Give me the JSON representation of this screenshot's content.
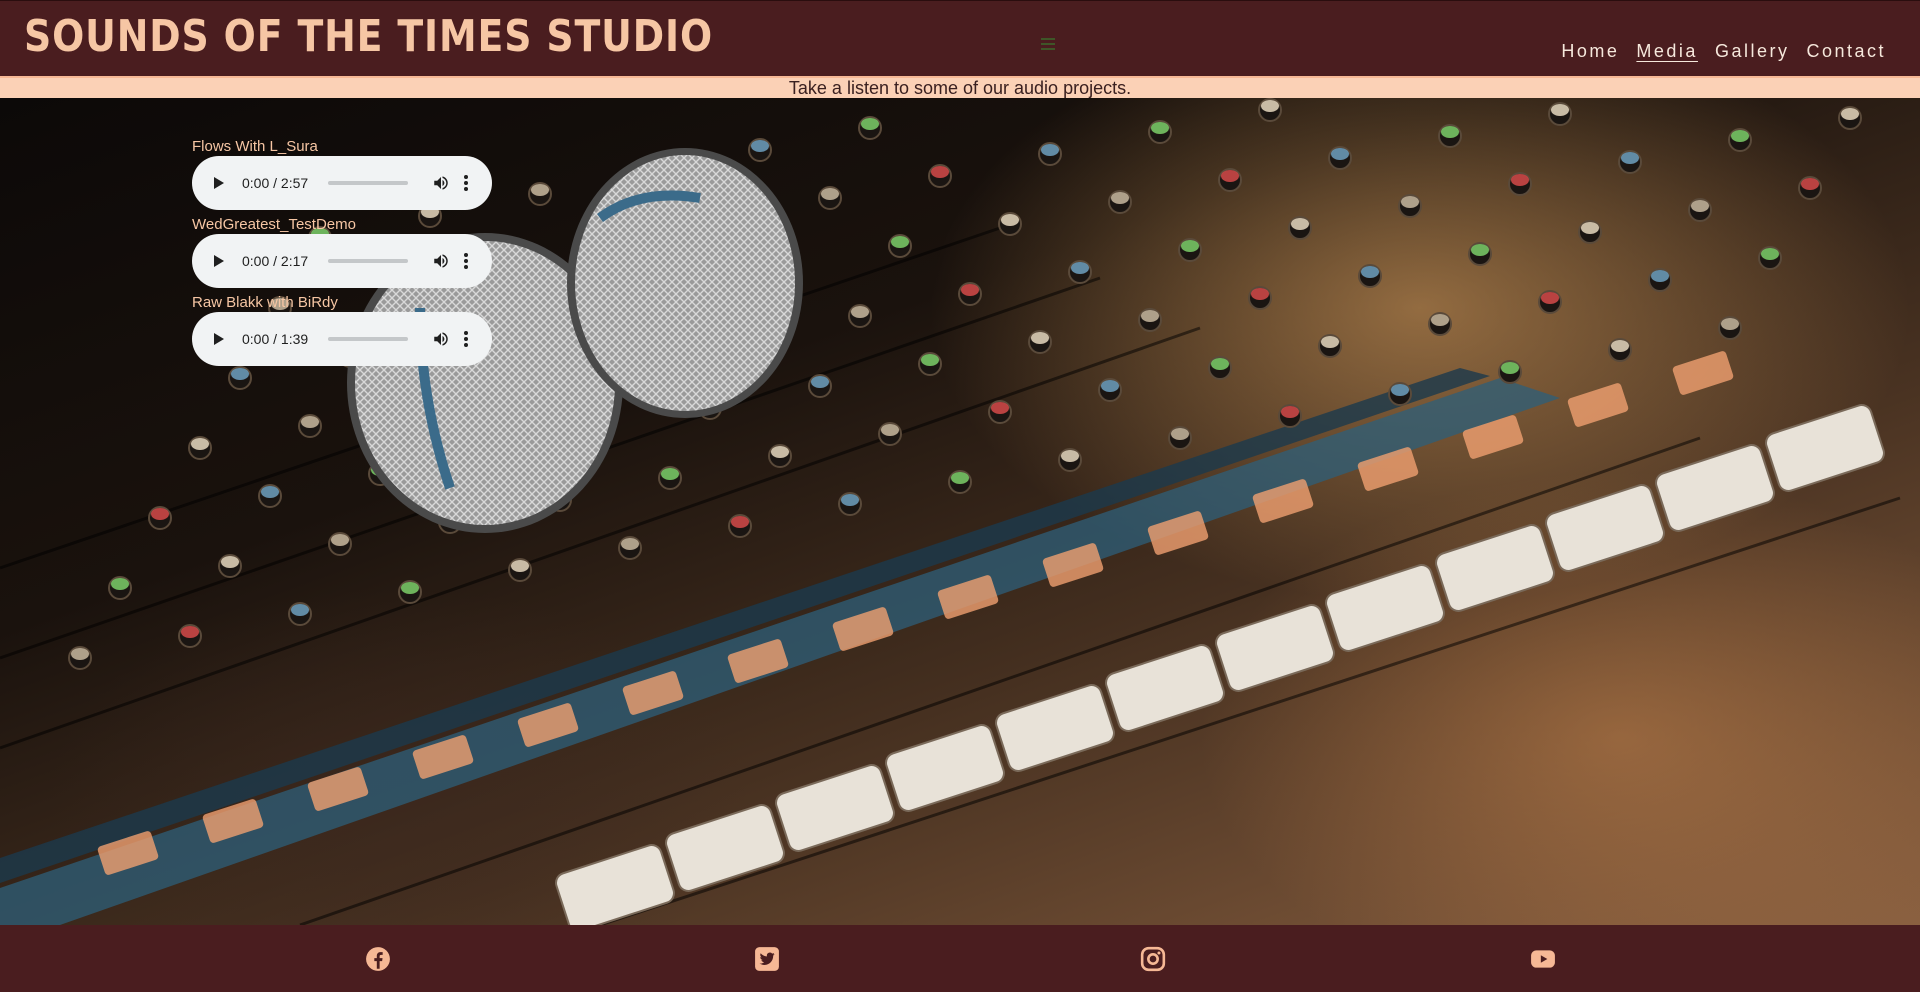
{
  "brand": {
    "title": "SOUNDS OF THE TIMES STUDIO"
  },
  "nav": {
    "items": [
      {
        "label": "Home",
        "active": false
      },
      {
        "label": "Media",
        "active": true
      },
      {
        "label": "Gallery",
        "active": false
      },
      {
        "label": "Contact",
        "active": false
      }
    ],
    "menu_icon": "hamburger-icon"
  },
  "tagline": "Take a listen to some of our audio projects.",
  "tracks": [
    {
      "title": "Flows With L_Sura",
      "time": "0:00 / 2:57",
      "progress": 0
    },
    {
      "title": "WedGreatest_TestDemo",
      "time": "0:00 / 2:17",
      "progress": 0
    },
    {
      "title": "Raw Blakk with BiRdy",
      "time": "0:00 / 1:39",
      "progress": 0
    }
  ],
  "player_icons": [
    "play-icon",
    "volume-icon",
    "more-options-icon"
  ],
  "footer": {
    "social": [
      {
        "name": "facebook-icon"
      },
      {
        "name": "twitter-icon"
      },
      {
        "name": "instagram-icon"
      },
      {
        "name": "youtube-icon"
      }
    ]
  },
  "colors": {
    "header_bg": "#4a1d1f",
    "brand_text": "#f6c6a4",
    "nav_text": "#f6e8dc",
    "tagline_bg": "#fbd1b6",
    "player_bg": "#f1f3f4",
    "footer_icon": "#f6b895"
  }
}
